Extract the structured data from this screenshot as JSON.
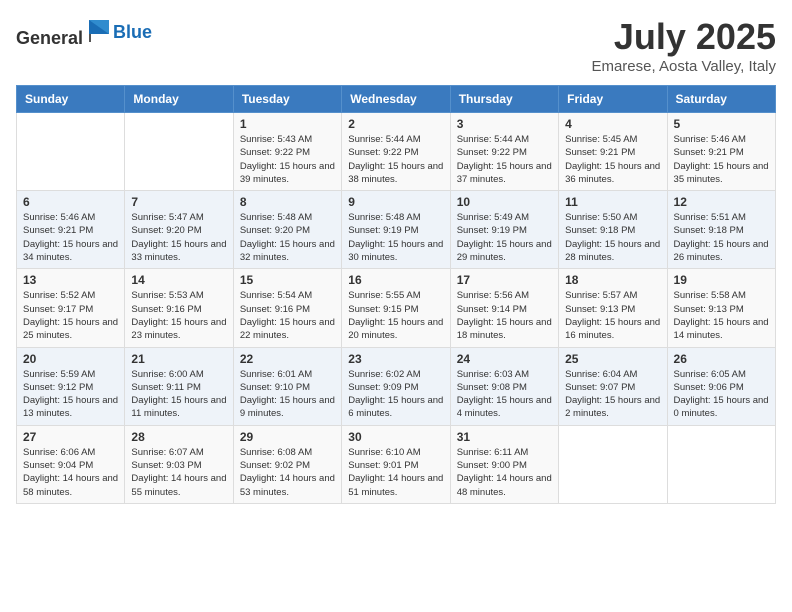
{
  "header": {
    "logo_general": "General",
    "logo_blue": "Blue",
    "month": "July 2025",
    "location": "Emarese, Aosta Valley, Italy"
  },
  "weekdays": [
    "Sunday",
    "Monday",
    "Tuesday",
    "Wednesday",
    "Thursday",
    "Friday",
    "Saturday"
  ],
  "weeks": [
    [
      {
        "day": "",
        "sunrise": "",
        "sunset": "",
        "daylight": ""
      },
      {
        "day": "",
        "sunrise": "",
        "sunset": "",
        "daylight": ""
      },
      {
        "day": "1",
        "sunrise": "Sunrise: 5:43 AM",
        "sunset": "Sunset: 9:22 PM",
        "daylight": "Daylight: 15 hours and 39 minutes."
      },
      {
        "day": "2",
        "sunrise": "Sunrise: 5:44 AM",
        "sunset": "Sunset: 9:22 PM",
        "daylight": "Daylight: 15 hours and 38 minutes."
      },
      {
        "day": "3",
        "sunrise": "Sunrise: 5:44 AM",
        "sunset": "Sunset: 9:22 PM",
        "daylight": "Daylight: 15 hours and 37 minutes."
      },
      {
        "day": "4",
        "sunrise": "Sunrise: 5:45 AM",
        "sunset": "Sunset: 9:21 PM",
        "daylight": "Daylight: 15 hours and 36 minutes."
      },
      {
        "day": "5",
        "sunrise": "Sunrise: 5:46 AM",
        "sunset": "Sunset: 9:21 PM",
        "daylight": "Daylight: 15 hours and 35 minutes."
      }
    ],
    [
      {
        "day": "6",
        "sunrise": "Sunrise: 5:46 AM",
        "sunset": "Sunset: 9:21 PM",
        "daylight": "Daylight: 15 hours and 34 minutes."
      },
      {
        "day": "7",
        "sunrise": "Sunrise: 5:47 AM",
        "sunset": "Sunset: 9:20 PM",
        "daylight": "Daylight: 15 hours and 33 minutes."
      },
      {
        "day": "8",
        "sunrise": "Sunrise: 5:48 AM",
        "sunset": "Sunset: 9:20 PM",
        "daylight": "Daylight: 15 hours and 32 minutes."
      },
      {
        "day": "9",
        "sunrise": "Sunrise: 5:48 AM",
        "sunset": "Sunset: 9:19 PM",
        "daylight": "Daylight: 15 hours and 30 minutes."
      },
      {
        "day": "10",
        "sunrise": "Sunrise: 5:49 AM",
        "sunset": "Sunset: 9:19 PM",
        "daylight": "Daylight: 15 hours and 29 minutes."
      },
      {
        "day": "11",
        "sunrise": "Sunrise: 5:50 AM",
        "sunset": "Sunset: 9:18 PM",
        "daylight": "Daylight: 15 hours and 28 minutes."
      },
      {
        "day": "12",
        "sunrise": "Sunrise: 5:51 AM",
        "sunset": "Sunset: 9:18 PM",
        "daylight": "Daylight: 15 hours and 26 minutes."
      }
    ],
    [
      {
        "day": "13",
        "sunrise": "Sunrise: 5:52 AM",
        "sunset": "Sunset: 9:17 PM",
        "daylight": "Daylight: 15 hours and 25 minutes."
      },
      {
        "day": "14",
        "sunrise": "Sunrise: 5:53 AM",
        "sunset": "Sunset: 9:16 PM",
        "daylight": "Daylight: 15 hours and 23 minutes."
      },
      {
        "day": "15",
        "sunrise": "Sunrise: 5:54 AM",
        "sunset": "Sunset: 9:16 PM",
        "daylight": "Daylight: 15 hours and 22 minutes."
      },
      {
        "day": "16",
        "sunrise": "Sunrise: 5:55 AM",
        "sunset": "Sunset: 9:15 PM",
        "daylight": "Daylight: 15 hours and 20 minutes."
      },
      {
        "day": "17",
        "sunrise": "Sunrise: 5:56 AM",
        "sunset": "Sunset: 9:14 PM",
        "daylight": "Daylight: 15 hours and 18 minutes."
      },
      {
        "day": "18",
        "sunrise": "Sunrise: 5:57 AM",
        "sunset": "Sunset: 9:13 PM",
        "daylight": "Daylight: 15 hours and 16 minutes."
      },
      {
        "day": "19",
        "sunrise": "Sunrise: 5:58 AM",
        "sunset": "Sunset: 9:13 PM",
        "daylight": "Daylight: 15 hours and 14 minutes."
      }
    ],
    [
      {
        "day": "20",
        "sunrise": "Sunrise: 5:59 AM",
        "sunset": "Sunset: 9:12 PM",
        "daylight": "Daylight: 15 hours and 13 minutes."
      },
      {
        "day": "21",
        "sunrise": "Sunrise: 6:00 AM",
        "sunset": "Sunset: 9:11 PM",
        "daylight": "Daylight: 15 hours and 11 minutes."
      },
      {
        "day": "22",
        "sunrise": "Sunrise: 6:01 AM",
        "sunset": "Sunset: 9:10 PM",
        "daylight": "Daylight: 15 hours and 9 minutes."
      },
      {
        "day": "23",
        "sunrise": "Sunrise: 6:02 AM",
        "sunset": "Sunset: 9:09 PM",
        "daylight": "Daylight: 15 hours and 6 minutes."
      },
      {
        "day": "24",
        "sunrise": "Sunrise: 6:03 AM",
        "sunset": "Sunset: 9:08 PM",
        "daylight": "Daylight: 15 hours and 4 minutes."
      },
      {
        "day": "25",
        "sunrise": "Sunrise: 6:04 AM",
        "sunset": "Sunset: 9:07 PM",
        "daylight": "Daylight: 15 hours and 2 minutes."
      },
      {
        "day": "26",
        "sunrise": "Sunrise: 6:05 AM",
        "sunset": "Sunset: 9:06 PM",
        "daylight": "Daylight: 15 hours and 0 minutes."
      }
    ],
    [
      {
        "day": "27",
        "sunrise": "Sunrise: 6:06 AM",
        "sunset": "Sunset: 9:04 PM",
        "daylight": "Daylight: 14 hours and 58 minutes."
      },
      {
        "day": "28",
        "sunrise": "Sunrise: 6:07 AM",
        "sunset": "Sunset: 9:03 PM",
        "daylight": "Daylight: 14 hours and 55 minutes."
      },
      {
        "day": "29",
        "sunrise": "Sunrise: 6:08 AM",
        "sunset": "Sunset: 9:02 PM",
        "daylight": "Daylight: 14 hours and 53 minutes."
      },
      {
        "day": "30",
        "sunrise": "Sunrise: 6:10 AM",
        "sunset": "Sunset: 9:01 PM",
        "daylight": "Daylight: 14 hours and 51 minutes."
      },
      {
        "day": "31",
        "sunrise": "Sunrise: 6:11 AM",
        "sunset": "Sunset: 9:00 PM",
        "daylight": "Daylight: 14 hours and 48 minutes."
      },
      {
        "day": "",
        "sunrise": "",
        "sunset": "",
        "daylight": ""
      },
      {
        "day": "",
        "sunrise": "",
        "sunset": "",
        "daylight": ""
      }
    ]
  ]
}
